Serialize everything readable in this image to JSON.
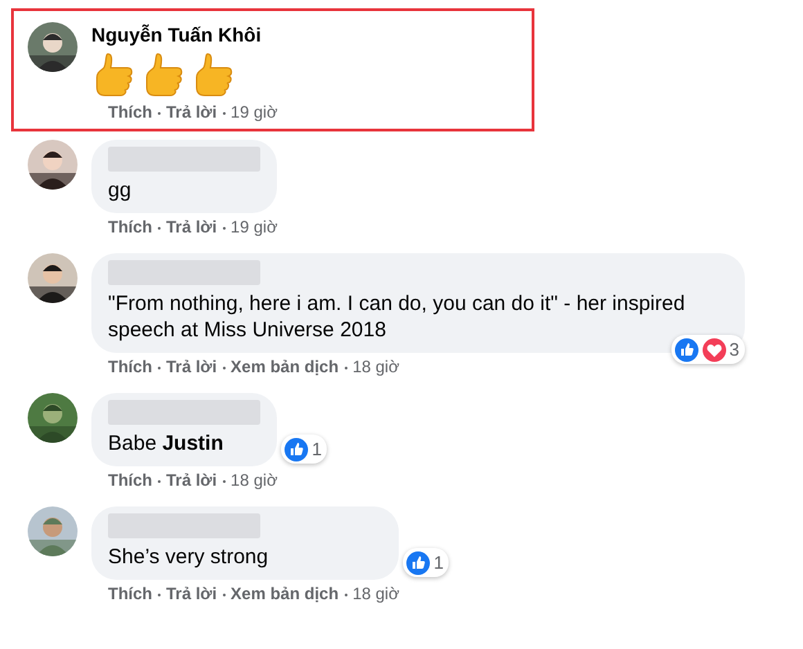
{
  "comments": [
    {
      "highlighted": true,
      "name": "Nguyễn Tuấn Khôi",
      "name_hidden": false,
      "emoji": [
        {
          "kind": "thumbs-up"
        },
        {
          "kind": "thumbs-up"
        },
        {
          "kind": "thumbs-up"
        }
      ],
      "actions": [
        "Thích",
        "Trả lời"
      ],
      "time": "19 giờ"
    },
    {
      "highlighted": false,
      "name_hidden": true,
      "text": "gg",
      "actions": [
        "Thích",
        "Trả lời"
      ],
      "time": "19 giờ"
    },
    {
      "highlighted": false,
      "name_hidden": true,
      "text": "\"From nothing, here i am. I can do, you can do it\" - her inspired speech at Miss Universe 2018",
      "reactions": {
        "icons": [
          {
            "kind": "like"
          },
          {
            "kind": "love"
          }
        ],
        "count": "3"
      },
      "actions": [
        "Thích",
        "Trả lời",
        "Xem bản dịch"
      ],
      "time": "18 giờ"
    },
    {
      "highlighted": false,
      "name_hidden": true,
      "text": "Babe **Justin**",
      "reactions": {
        "icons": [
          {
            "kind": "like"
          }
        ],
        "count": "1"
      },
      "actions": [
        "Thích",
        "Trả lời"
      ],
      "time": "18 giờ"
    },
    {
      "highlighted": false,
      "name_hidden": true,
      "text": "She’s very strong",
      "reactions": {
        "icons": [
          {
            "kind": "like"
          }
        ],
        "count": "1"
      },
      "actions": [
        "Thích",
        "Trả lời",
        "Xem bản dịch"
      ],
      "time": "18 giờ"
    }
  ]
}
